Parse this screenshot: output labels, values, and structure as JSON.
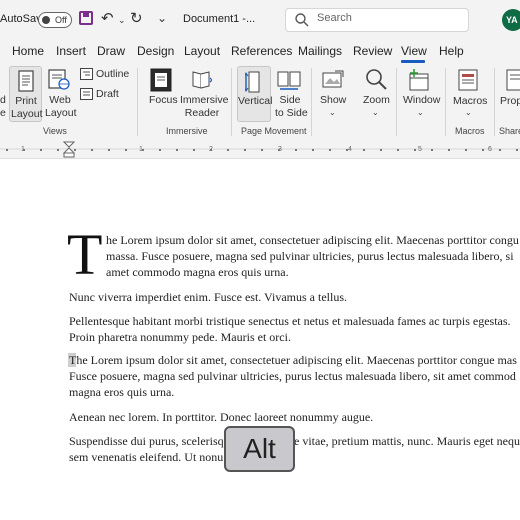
{
  "titlebar": {
    "autosave_label": "AutoSave",
    "autosave_state": "Off",
    "document_title": "Document1  -...",
    "search_placeholder": "Search",
    "avatar_initials": "YA"
  },
  "tabs": [
    "Home",
    "Insert",
    "Draw",
    "Design",
    "Layout",
    "References",
    "Mailings",
    "Review",
    "View",
    "Help"
  ],
  "active_tab": "View",
  "ribbon": {
    "views": {
      "label": "Views",
      "read_mode_fragment": "d\ne",
      "print_layout": "Print\nLayout",
      "web_layout": "Web\nLayout",
      "outline": "Outline",
      "draft": "Draft"
    },
    "immersive": {
      "label": "Immersive",
      "focus": "Focus",
      "immersive_reader": "Immersive\nReader"
    },
    "page_movement": {
      "label": "Page Movement",
      "vertical": "Vertical",
      "side_to_side": "Side\nto Side"
    },
    "show": "Show",
    "zoom": "Zoom",
    "window": "Window",
    "macros": {
      "button": "Macros",
      "label": "Macros"
    },
    "properties_fragment": "Prope",
    "share_fragment": "Share"
  },
  "ruler": {
    "numbers": [
      "1",
      "1",
      "2",
      "3",
      "4",
      "5",
      "6"
    ]
  },
  "document": {
    "dropcap": "T",
    "p1": [
      "he Lorem ipsum dolor sit amet, consectetuer adipiscing elit. Maecenas porttitor congu",
      "massa. Fusce posuere, magna sed pulvinar ultricies, purus lectus malesuada libero, si",
      "amet commodo magna eros quis urna."
    ],
    "p2": "Nunc viverra imperdiet enim. Fusce est. Vivamus a tellus.",
    "p3": [
      "Pellentesque habitant morbi tristique senectus et netus et malesuada fames ac turpis egestas.",
      "Proin pharetra nonummy pede. Mauris et orci."
    ],
    "p4": [
      "The Lorem ipsum dolor sit amet, consectetuer adipiscing elit. Maecenas porttitor congue mas",
      "Fusce posuere, magna sed pulvinar ultricies, purus lectus malesuada libero, sit amet commod",
      "magna eros quis urna."
    ],
    "p5": "Aenean nec lorem. In porttitor. Donec laoreet nonummy augue.",
    "p6": [
      "Suspendisse dui purus, scelerisq",
      "e vitae, pretium mattis, nunc. Mauris eget nequ",
      "sem venenatis eleifend. Ut nonu"
    ]
  },
  "overlay": {
    "key_label": "Alt"
  },
  "colors": {
    "accent": "#185abd",
    "save_icon": "#7b2d8b",
    "avatar_bg": "#0e6b43"
  }
}
